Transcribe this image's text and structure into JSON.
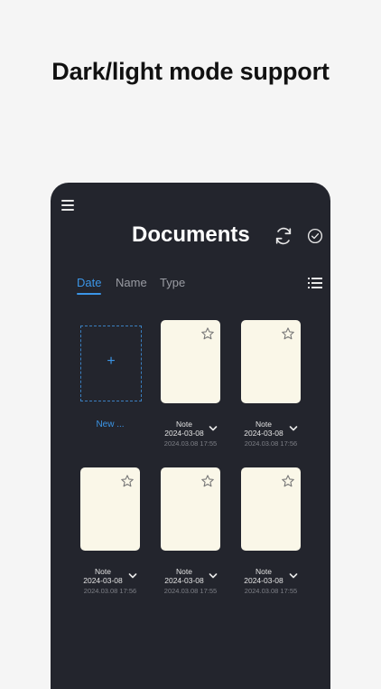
{
  "headline": "Dark/light mode support",
  "header": {
    "title": "Documents"
  },
  "tabs": [
    {
      "label": "Date",
      "active": true
    },
    {
      "label": "Name",
      "active": false
    },
    {
      "label": "Type",
      "active": false
    }
  ],
  "new_document": {
    "plus": "+",
    "label": "New ..."
  },
  "notes": [
    {
      "name": "Note",
      "date": "2024-03-08",
      "time": "2024.03.08 17:55"
    },
    {
      "name": "Note",
      "date": "2024-03-08",
      "time": "2024.03.08 17:56"
    },
    {
      "name": "Note",
      "date": "2024-03-08",
      "time": "2024.03.08 17:56"
    },
    {
      "name": "Note",
      "date": "2024-03-08",
      "time": "2024.03.08 17:55"
    },
    {
      "name": "Note",
      "date": "2024-03-08",
      "time": "2024.03.08 17:55"
    }
  ],
  "colors": {
    "accent": "#3b95e6",
    "panel": "#23252d",
    "card": "#faf7e8"
  },
  "icons": [
    "menu-icon",
    "sync-icon",
    "check-circle-icon",
    "list-view-icon",
    "star-icon",
    "chevron-down-icon"
  ]
}
